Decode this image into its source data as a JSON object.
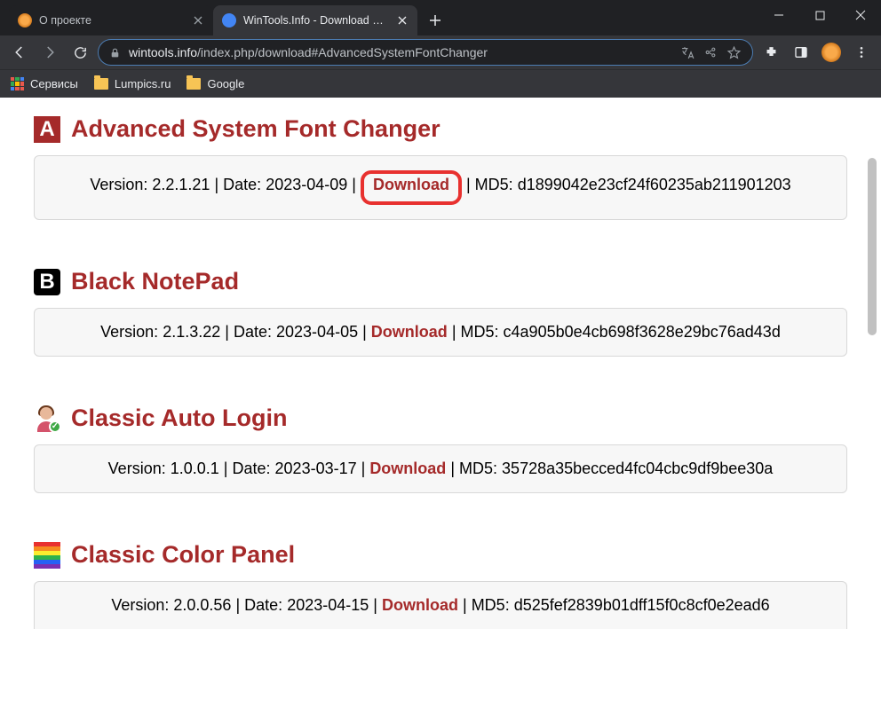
{
  "browser": {
    "tabs": [
      {
        "title": "О проекте",
        "active": false
      },
      {
        "title": "WinTools.Info - Download Center",
        "active": true
      }
    ],
    "address": {
      "host": "wintools.info",
      "path": "/index.php/download#AdvancedSystemFontChanger"
    },
    "bookmarks": {
      "apps": "Сервисы",
      "items": [
        "Lumpics.ru",
        "Google"
      ]
    }
  },
  "page": {
    "sections": [
      {
        "title": "Advanced System Font Changer",
        "version_label": "Version:",
        "version": "2.2.1.21",
        "date_label": "Date:",
        "date": "2023-04-09",
        "download": "Download",
        "md5_label": "MD5:",
        "md5": "d1899042e23cf24f60235ab211901203",
        "highlighted": true
      },
      {
        "title": "Black NotePad",
        "version_label": "Version:",
        "version": "2.1.3.22",
        "date_label": "Date:",
        "date": "2023-04-05",
        "download": "Download",
        "md5_label": "MD5:",
        "md5": "c4a905b0e4cb698f3628e29bc76ad43d",
        "highlighted": false
      },
      {
        "title": "Classic Auto Login",
        "version_label": "Version:",
        "version": "1.0.0.1",
        "date_label": "Date:",
        "date": "2023-03-17",
        "download": "Download",
        "md5_label": "MD5:",
        "md5": "35728a35becced4fc04cbc9df9bee30a",
        "highlighted": false
      },
      {
        "title": "Classic Color Panel",
        "version_label": "Version:",
        "version": "2.0.0.56",
        "date_label": "Date:",
        "date": "2023-04-15",
        "download": "Download",
        "md5_label": "MD5:",
        "md5": "d525fef2839b01dff15f0c8cf0e2ead6",
        "highlighted": false
      }
    ]
  }
}
